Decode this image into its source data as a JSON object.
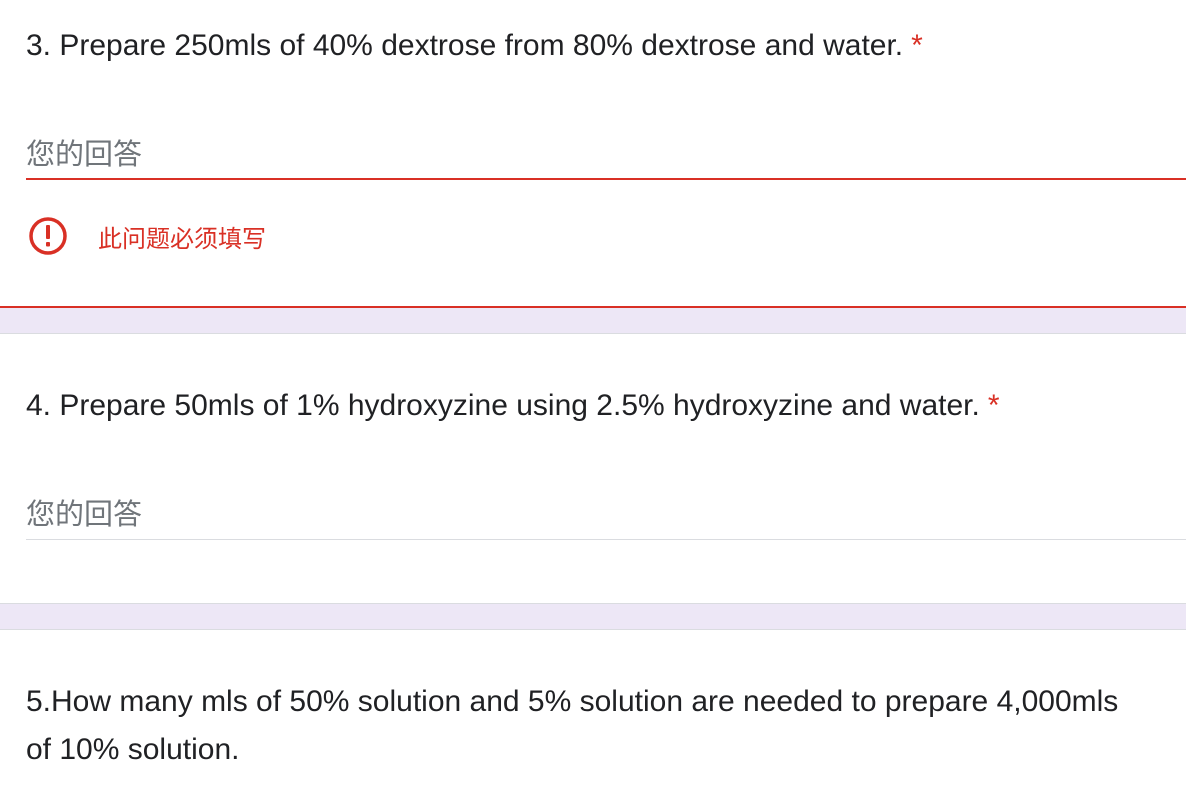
{
  "questions": [
    {
      "title": "3. Prepare 250mls of 40% dextrose from 80% dextrose  and water.",
      "required_mark": "*",
      "answer_placeholder": "您的回答",
      "error_message": "此问题必须填写"
    },
    {
      "title": "4. Prepare 50mls of 1% hydroxyzine using 2.5% hydroxyzine and water.",
      "required_mark": "*",
      "answer_placeholder": "您的回答"
    },
    {
      "title": "5.How many mls of 50% solution and 5% solution are needed to prepare 4,000mls of 10% solution."
    }
  ],
  "colors": {
    "error": "#d93025",
    "background": "#ede7f6",
    "card": "#ffffff",
    "text": "#202124",
    "placeholder": "#70757a",
    "divider": "#dadce0"
  },
  "icons": {
    "error": "error-circle-exclamation-icon"
  }
}
